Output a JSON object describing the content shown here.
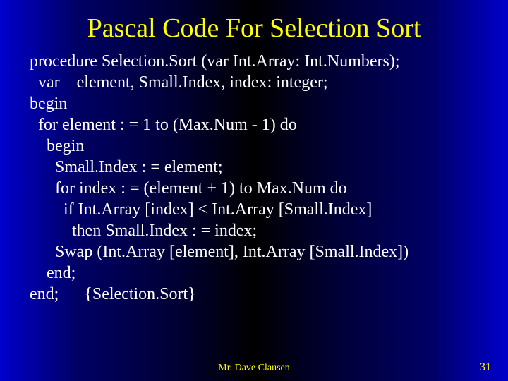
{
  "slide": {
    "title": "Pascal Code For Selection Sort",
    "code_lines": [
      "procedure Selection.Sort (var Int.Array: Int.Numbers);",
      "  var    element, Small.Index, index: integer;",
      "begin",
      "  for element : = 1 to (Max.Num - 1) do",
      "    begin",
      "      Small.Index : = element;",
      "      for index : = (element + 1) to Max.Num do",
      "        if Int.Array [index] < Int.Array [Small.Index]",
      "          then Small.Index : = index;",
      "      Swap (Int.Array [element], Int.Array [Small.Index])",
      "    end;",
      "end;      {Selection.Sort}"
    ],
    "author": "Mr. Dave Clausen",
    "page_number": "31"
  }
}
